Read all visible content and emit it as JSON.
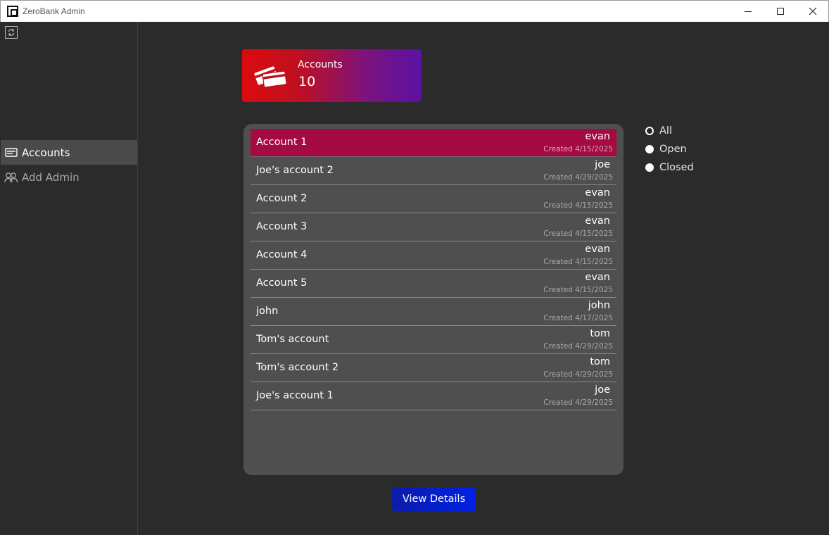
{
  "window": {
    "title": "ZeroBank Admin",
    "controls": [
      "minimize-icon",
      "maximize-icon",
      "close-icon"
    ]
  },
  "sidebar": {
    "refresh_icon": "refresh-icon",
    "items": [
      {
        "label": "Accounts",
        "icon": "account-card-icon",
        "active": true
      },
      {
        "label": "Add Admin",
        "icon": "add-admin-icon",
        "active": false
      }
    ]
  },
  "stat_card": {
    "label": "Accounts",
    "value": "10",
    "icon": "credit-cards-icon"
  },
  "accounts": [
    {
      "name": "Account 1",
      "owner": "evan",
      "created": "Created 4/15/2025",
      "selected": true
    },
    {
      "name": "Joe's account 2",
      "owner": "joe",
      "created": "Created 4/29/2025"
    },
    {
      "name": "Account 2",
      "owner": "evan",
      "created": "Created 4/15/2025"
    },
    {
      "name": "Account 3",
      "owner": "evan",
      "created": "Created 4/15/2025"
    },
    {
      "name": "Account 4",
      "owner": "evan",
      "created": "Created 4/15/2025"
    },
    {
      "name": "Account 5",
      "owner": "evan",
      "created": "Created 4/15/2025"
    },
    {
      "name": "john",
      "owner": "john",
      "created": "Created 4/17/2025"
    },
    {
      "name": "Tom's account",
      "owner": "tom",
      "created": "Created 4/29/2025"
    },
    {
      "name": "Tom's account 2",
      "owner": "tom",
      "created": "Created 4/29/2025"
    },
    {
      "name": "Joe's account 1",
      "owner": "joe",
      "created": "Created 4/29/2025"
    }
  ],
  "filters": {
    "options": [
      "All",
      "Open",
      "Closed"
    ],
    "selected": "All"
  },
  "actions": {
    "view_details": "View Details"
  },
  "colors": {
    "background": "#2b2b2b",
    "panel": "#4f4f4f",
    "selected_row": "#a50a42",
    "button": "#0020e6",
    "card_gradient_start": "#dc0a0e",
    "card_gradient_end": "#5a12a4"
  }
}
